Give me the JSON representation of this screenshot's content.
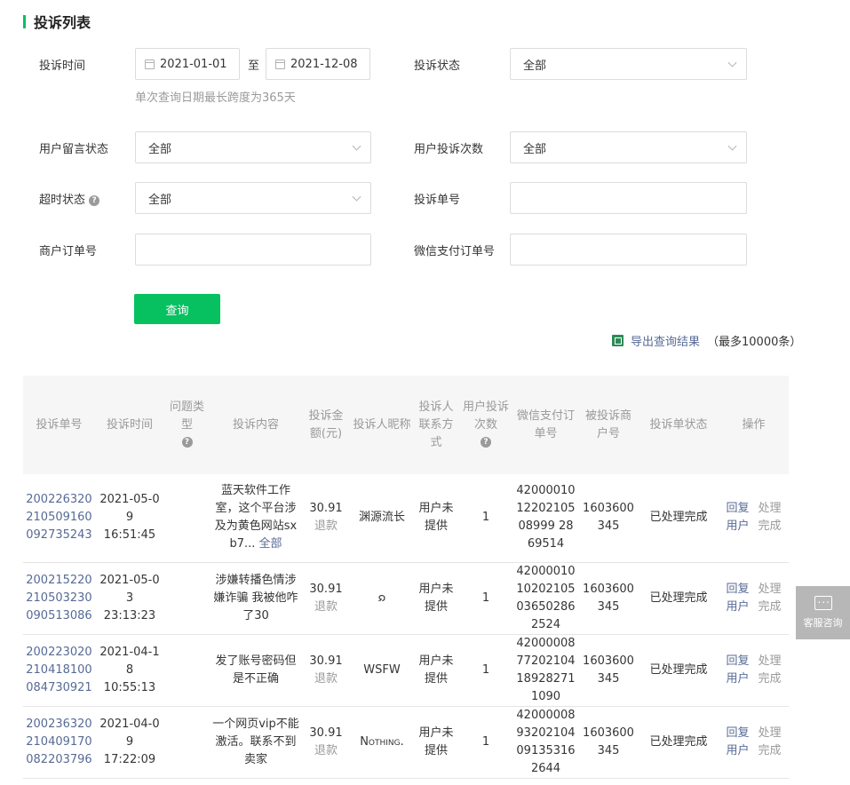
{
  "page": {
    "title": "投诉列表"
  },
  "filters": {
    "time_label": "投诉时间",
    "date_start": "2021-01-01",
    "date_sep": "至",
    "date_end": "2021-12-08",
    "date_hint": "单次查询日期最长跨度为365天",
    "status_label": "投诉状态",
    "status_value": "全部",
    "msg_status_label": "用户留言状态",
    "msg_status_value": "全部",
    "count_label": "用户投诉次数",
    "count_value": "全部",
    "timeout_label": "超时状态",
    "timeout_value": "全部",
    "complaint_no_label": "投诉单号",
    "complaint_no_value": "",
    "merchant_order_label": "商户订单号",
    "merchant_order_value": "",
    "wx_order_label": "微信支付订单号",
    "wx_order_value": "",
    "query_button": "查询"
  },
  "export": {
    "link": "导出查询结果",
    "note": "（最多10000条）"
  },
  "icons": {
    "help": "question-icon",
    "calendar": "calendar-icon",
    "excel": "excel-icon",
    "chat": "chat-icon"
  },
  "table": {
    "headers": {
      "no": "投诉单号",
      "time": "投诉时间",
      "type": "问题类型",
      "content": "投诉内容",
      "amount": "投诉金额(元)",
      "nick": "投诉人昵称",
      "contact": "投诉人联系方式",
      "times": "用户投诉次数",
      "wx_order": "微信支付订单号",
      "merchant": "被投诉商户号",
      "state": "投诉单状态",
      "ops": "操作"
    },
    "rows": [
      {
        "no": "200226320210509160092735243",
        "date": "2021-05-09",
        "clock": "16:51:45",
        "type": "",
        "content": "蓝天软件工作室，这个平台涉及为黄色网站sxb7...",
        "more": "全部",
        "amount": "30.91",
        "refund": "退款",
        "nick": "渊源流长",
        "contact": "用户未提供",
        "times": "1",
        "wx_order": "420000101220210508999 2869514",
        "merchant": "1603600345",
        "state": "已处理完成",
        "reply": "回复用户",
        "handle": "处理完成"
      },
      {
        "no": "200215220210503230090513086",
        "date": "2021-05-03",
        "clock": "23:13:23",
        "type": "",
        "content": "涉嫌转播色情涉嫌诈骗 我被他咋了30",
        "more": "",
        "amount": "30.91",
        "refund": "退款",
        "nick": "𐑸",
        "contact": "用户未提供",
        "times": "1",
        "wx_order": "4200001010202105036502862524",
        "merchant": "1603600345",
        "state": "已处理完成",
        "reply": "回复用户",
        "handle": "处理完成"
      },
      {
        "no": "200223020210418100084730921",
        "date": "2021-04-18",
        "clock": "10:55:13",
        "type": "",
        "content": "发了账号密码但是不正确",
        "more": "",
        "amount": "30.91",
        "refund": "退款",
        "nick": "WSFW",
        "contact": "用户未提供",
        "times": "1",
        "wx_order": "4200000877202104189282711090",
        "merchant": "1603600345",
        "state": "已处理完成",
        "reply": "回复用户",
        "handle": "处理完成"
      },
      {
        "no": "200236320210409170082203796",
        "date": "2021-04-09",
        "clock": "17:22:09",
        "type": "",
        "content": "一个网页vip不能激活。联系不到卖家",
        "more": "",
        "amount": "30.91",
        "refund": "退款",
        "nick": "Nothing.",
        "contact": "用户未提供",
        "times": "1",
        "wx_order": "4200000893202104091353162644",
        "merchant": "1603600345",
        "state": "已处理完成",
        "reply": "回复用户",
        "handle": "处理完成"
      }
    ]
  },
  "float": {
    "label": "客服咨询"
  }
}
